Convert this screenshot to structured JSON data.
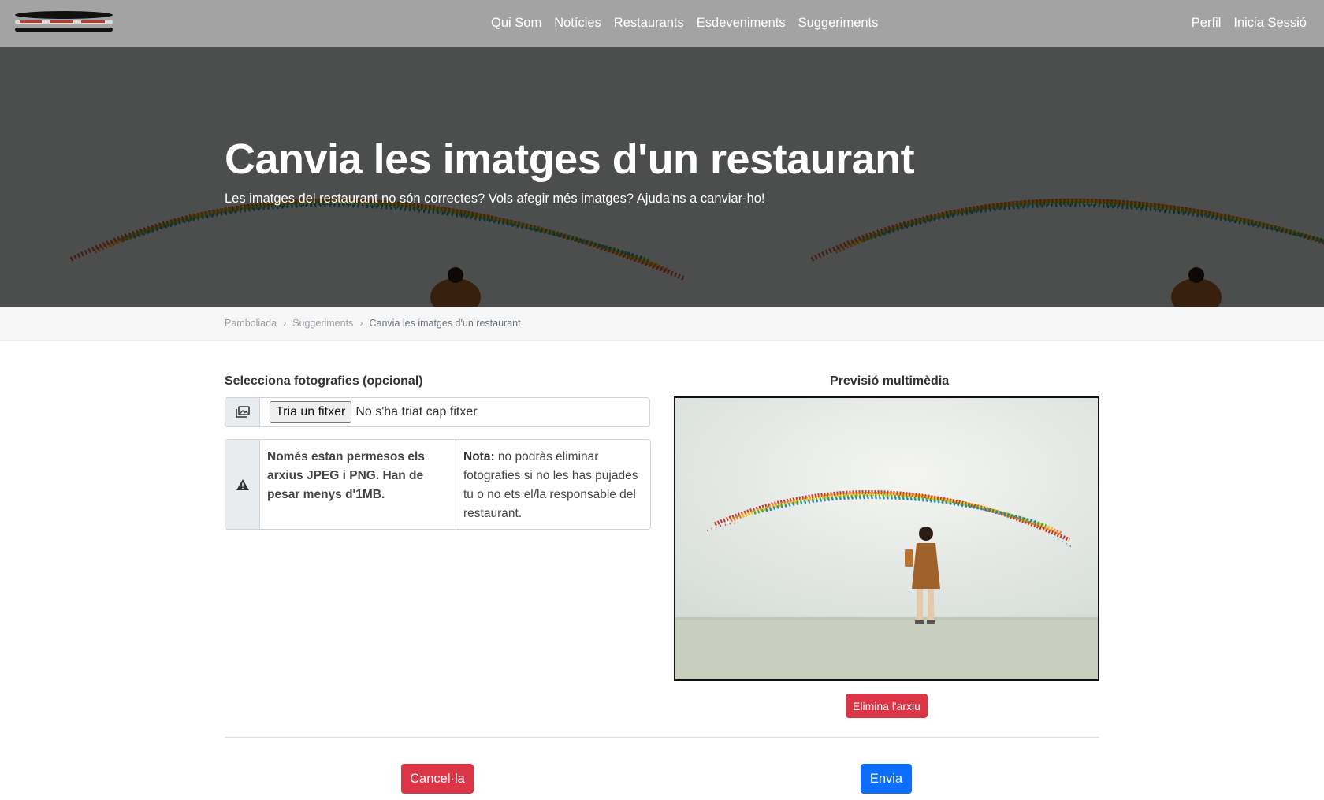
{
  "nav": {
    "logo_icon": "stacked-bars-logo",
    "center_links": [
      "Qui Som",
      "Notícies",
      "Restaurants",
      "Esdeveniments",
      "Suggeriments"
    ],
    "right_links": [
      "Perfil",
      "Inicia Sessió"
    ]
  },
  "hero": {
    "title": "Canvia les imatges d'un restaurant",
    "subtitle": "Les imatges del restaurant no són correctes? Vols afegir més imatges? Ajuda'ns a canviar-ho!",
    "background_image": "rainbow-wall-photo"
  },
  "breadcrumb": {
    "items": [
      "Pamboliada",
      "Suggeriments"
    ],
    "separator": "›",
    "current": "Canvia les imatges d'un restaurant"
  },
  "form": {
    "photos_label": "Selecciona fotografies (opcional)",
    "addon_icon": "images-icon",
    "choose_file_label": "Tria un fitxer",
    "no_file_text": "No s'ha triat cap fitxer",
    "warning_icon": "warning-triangle-icon",
    "warning_text": "Només estan permesos els arxius JPEG i PNG. Han de pesar menys d'1MB.",
    "note_label": "Nota:",
    "note_text": " no podràs eliminar fotografies si no les has pujades tu o no ets el/la responsable del restaurant."
  },
  "preview": {
    "label": "Previsió multimèdia",
    "image": "rainbow-wall-photo",
    "remove_label": "Elimina l'arxiu"
  },
  "actions": {
    "cancel_label": "Cancel·la",
    "submit_label": "Envia"
  },
  "colors": {
    "navbar": "#a3a3a3",
    "danger": "#dc3545",
    "primary": "#0d6efd"
  }
}
